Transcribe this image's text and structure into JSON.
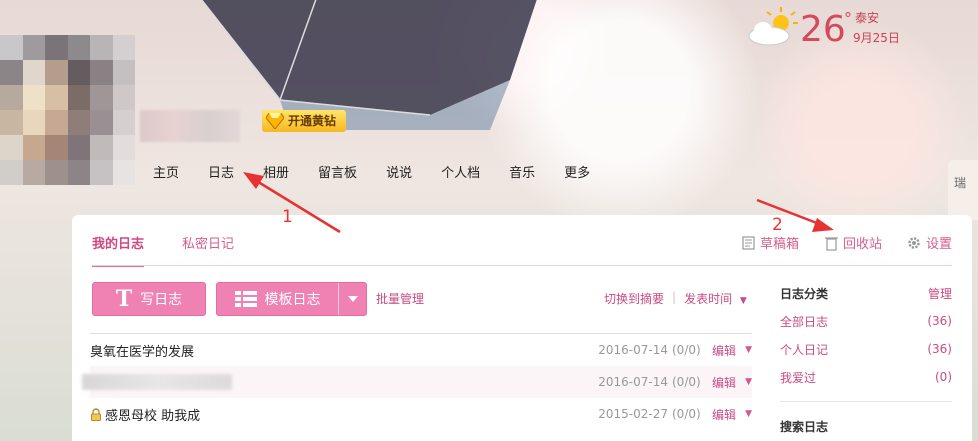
{
  "weather": {
    "temperature": "26",
    "degree_symbol": "°",
    "city": "泰安",
    "date": "9月25日",
    "icon": "partly-cloudy-icon"
  },
  "profile": {
    "vip_badge": "开通黄钻"
  },
  "nav": {
    "items": [
      "主页",
      "日志",
      "相册",
      "留言板",
      "说说",
      "个人档",
      "音乐",
      "更多"
    ]
  },
  "annotations": {
    "label_1": "1",
    "label_2": "2",
    "color": "#e53333"
  },
  "tabs": [
    "我的日志",
    "私密日记"
  ],
  "tools": {
    "drafts": "草稿箱",
    "recycle": "回收站",
    "settings": "设置"
  },
  "actions": {
    "write": "写日志",
    "template": "模板日志",
    "batch": "批量管理",
    "switch_summary": "切换到摘要",
    "sort_by_time": "发表时间"
  },
  "posts": [
    {
      "title": "臭氧在医学的发展",
      "date": "2016-07-14",
      "count": "(0/0)",
      "edit": "编辑",
      "locked": false,
      "blurred": false
    },
    {
      "title": "",
      "date": "2016-07-14",
      "count": "(0/0)",
      "edit": "编辑",
      "locked": false,
      "blurred": true
    },
    {
      "title": "感恩母校 助我成",
      "date": "2015-02-27",
      "count": "(0/0)",
      "edit": "编辑",
      "locked": true,
      "blurred": false
    }
  ],
  "sidebar": {
    "category_title": "日志分类",
    "manage": "管理",
    "categories": [
      {
        "name": "全部日志",
        "count": "(36)"
      },
      {
        "name": "个人日记",
        "count": "(36)"
      },
      {
        "name": "我爱过",
        "count": "(0)"
      }
    ],
    "search_title": "搜索日志"
  },
  "edge_tab": "瑞",
  "colors": {
    "accent": "#e06b9a",
    "button": "#ef82b3",
    "weather": "#d24a5c"
  }
}
